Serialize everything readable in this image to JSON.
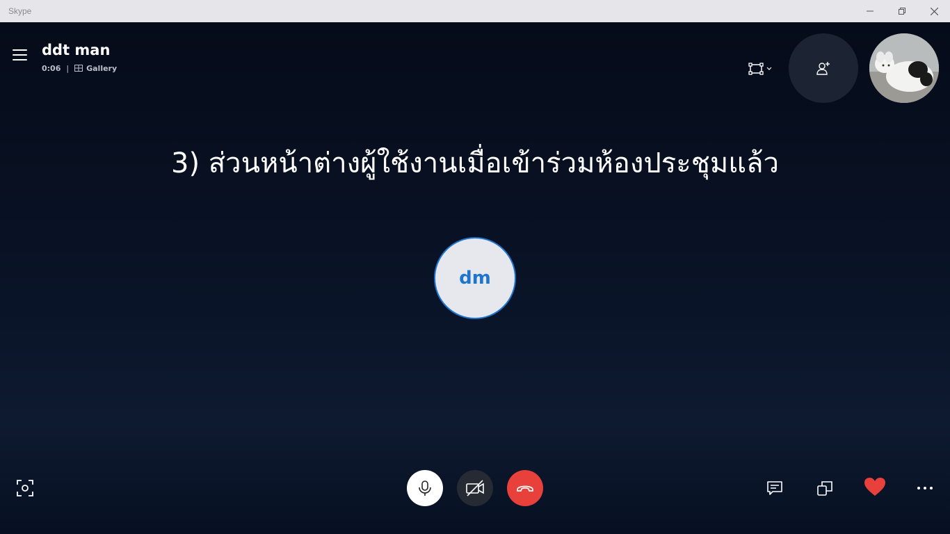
{
  "window": {
    "title": "Skype",
    "controls": [
      "minimize-icon",
      "restore-icon",
      "close-icon"
    ]
  },
  "call": {
    "name": "ddt man",
    "duration": "0:06",
    "separator": "|",
    "view_mode": "Gallery"
  },
  "caption": "3) ส่วนหน้าต่างผู้ใช้งานเมื่อเข้าร่วมห้องประชุมแล้ว",
  "participant": {
    "initials": "dm"
  },
  "toolbar": {
    "left": [
      "snapshot-icon"
    ],
    "center": [
      "microphone-icon",
      "video-off-icon",
      "hang-up-icon"
    ],
    "right": [
      "chat-icon",
      "share-screen-icon",
      "heart-icon",
      "more-icon"
    ]
  },
  "top_right": [
    "layout-icon",
    "add-people-icon",
    "self-avatar"
  ],
  "colors": {
    "background": "#0b1424",
    "hangup": "#e8403a",
    "accent": "#1f75cc",
    "heart": "#e8403a"
  }
}
